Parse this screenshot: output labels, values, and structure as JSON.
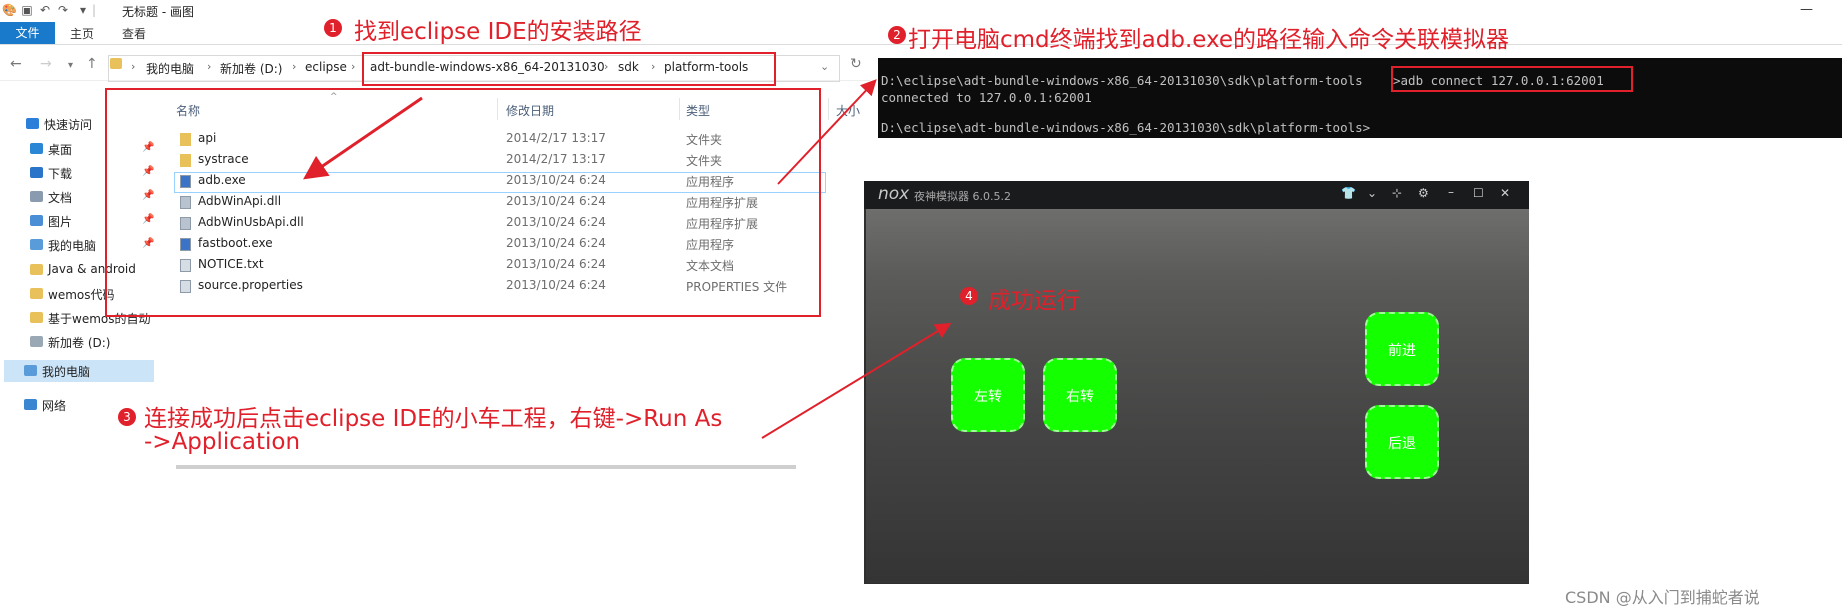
{
  "paint": {
    "title": "无标题 - 画图",
    "tabs": [
      "文件",
      "主页",
      "查看"
    ],
    "window_controls": [
      "—"
    ]
  },
  "explorer": {
    "breadcrumb": [
      "我的电脑",
      "新加卷 (D:)",
      "eclipse",
      "adt-bundle-windows-x86_64-20131030",
      "sdk",
      "platform-tools"
    ],
    "columns": {
      "name": "名称",
      "date": "修改日期",
      "type": "类型",
      "size": "大小"
    },
    "sidebar": [
      {
        "label": "快速访问",
        "icon": "star-icon",
        "pinned": false
      },
      {
        "label": "桌面",
        "icon": "desktop-icon",
        "pinned": true
      },
      {
        "label": "下载",
        "icon": "download-icon",
        "pinned": true
      },
      {
        "label": "文档",
        "icon": "document-icon",
        "pinned": true
      },
      {
        "label": "图片",
        "icon": "picture-icon",
        "pinned": true
      },
      {
        "label": "我的电脑",
        "icon": "computer-icon",
        "pinned": true
      },
      {
        "label": "Java & android",
        "icon": "folder-icon",
        "pinned": false
      },
      {
        "label": "wemos代码",
        "icon": "folder-icon",
        "pinned": false
      },
      {
        "label": "基于wemos的自动",
        "icon": "folder-icon",
        "pinned": false
      },
      {
        "label": "新加卷 (D:)",
        "icon": "drive-icon",
        "pinned": false
      },
      {
        "label": "我的电脑",
        "icon": "computer-icon",
        "pinned": false
      },
      {
        "label": "网络",
        "icon": "network-icon",
        "pinned": false
      }
    ],
    "files": [
      {
        "name": "api",
        "date": "2014/2/17 13:17",
        "type": "文件夹",
        "icon": "folder-icon"
      },
      {
        "name": "systrace",
        "date": "2014/2/17 13:17",
        "type": "文件夹",
        "icon": "folder-icon"
      },
      {
        "name": "adb.exe",
        "date": "2013/10/24 6:24",
        "type": "应用程序",
        "icon": "exe-icon"
      },
      {
        "name": "AdbWinApi.dll",
        "date": "2013/10/24 6:24",
        "type": "应用程序扩展",
        "icon": "dll-icon"
      },
      {
        "name": "AdbWinUsbApi.dll",
        "date": "2013/10/24 6:24",
        "type": "应用程序扩展",
        "icon": "dll-icon"
      },
      {
        "name": "fastboot.exe",
        "date": "2013/10/24 6:24",
        "type": "应用程序",
        "icon": "exe-icon"
      },
      {
        "name": "NOTICE.txt",
        "date": "2013/10/24 6:24",
        "type": "文本文档",
        "icon": "text-file-icon"
      },
      {
        "name": "source.properties",
        "date": "2013/10/24 6:24",
        "type": "PROPERTIES 文件",
        "icon": "file-icon"
      }
    ]
  },
  "cmd": {
    "line1_prompt": "D:\\eclipse\\adt-bundle-windows-x86_64-20131030\\sdk\\platform-tools",
    "line1_cmd": ">adb connect 127.0.0.1:62001",
    "line2": "connected to 127.0.0.1:62001",
    "line3": "D:\\eclipse\\adt-bundle-windows-x86_64-20131030\\sdk\\platform-tools>"
  },
  "nox": {
    "logo": "nox",
    "title": "夜神模拟器 6.0.5.2",
    "buttons": {
      "left": "左转",
      "right": "右转",
      "forward": "前进",
      "back": "后退"
    }
  },
  "annotations": {
    "a1_num": "1",
    "a1": "找到eclipse IDE的安装路径",
    "a2_num": "2",
    "a2": "打开电脑cmd终端找到adb.exe的路径输入命令关联模拟器",
    "a3_num": "3",
    "a3_line1": "连接成功后点击eclipse IDE的小车工程，右键->Run As",
    "a3_line2": "->Application",
    "a4_num": "4",
    "a4": "成功运行"
  },
  "watermark": "CSDN @从入门到捕蛇者说",
  "colors": {
    "accent_red": "#e0202a",
    "nox_button_green": "#14ff00",
    "paint_file_tab": "#1979ca"
  }
}
